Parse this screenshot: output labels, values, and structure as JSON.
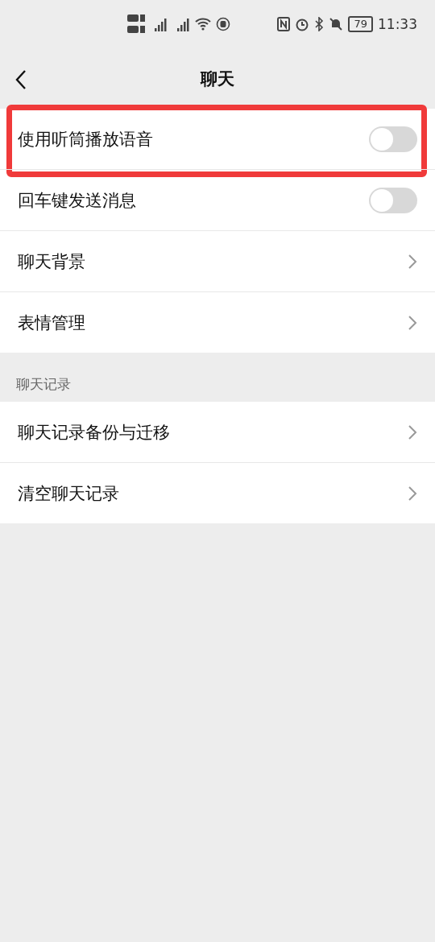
{
  "status_bar": {
    "battery": "79",
    "time": "11:33"
  },
  "header": {
    "title": "聊天"
  },
  "sections": [
    {
      "rows": [
        {
          "kind": "switch",
          "label": "使用听筒播放语音",
          "on": false,
          "highlighted": true
        },
        {
          "kind": "switch",
          "label": "回车键发送消息",
          "on": false,
          "highlighted": false
        },
        {
          "kind": "link",
          "label": "聊天背景",
          "highlighted": false
        },
        {
          "kind": "link",
          "label": "表情管理",
          "highlighted": false
        }
      ]
    },
    {
      "title": "聊天记录",
      "rows": [
        {
          "kind": "link",
          "label": "聊天记录备份与迁移",
          "highlighted": false
        },
        {
          "kind": "link",
          "label": "清空聊天记录",
          "highlighted": false
        }
      ]
    }
  ]
}
